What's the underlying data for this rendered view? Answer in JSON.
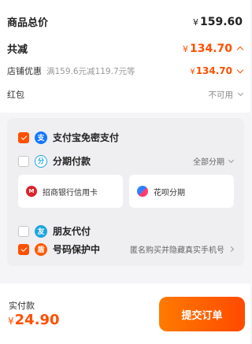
{
  "summary": {
    "total_label": "商品总价",
    "total_currency": "¥",
    "total_value": "159.60",
    "discount_label": "共减",
    "discount_currency": "¥",
    "discount_value": "134.70",
    "store_label": "店铺优惠",
    "store_desc": "满159.6元减119.7元等",
    "store_currency": "¥",
    "store_value": "134.70",
    "redpack_label": "红包",
    "redpack_value": "不可用"
  },
  "payment": {
    "alipay_label": "支付宝免密支付",
    "alipay_checked": true,
    "installment_label": "分期付款",
    "installment_checked": false,
    "installment_link": "全部分期",
    "banks": [
      "招商银行信用卡",
      "花呗分期"
    ],
    "friend_label": "朋友代付",
    "friend_checked": false,
    "privacy_label": "号码保护中",
    "privacy_checked": true,
    "privacy_desc": "匿名购买并隐藏真实手机号"
  },
  "footer": {
    "pay_label": "实付款",
    "pay_currency": "¥",
    "pay_value": "24.90",
    "submit_label": "提交订单"
  },
  "colors": {
    "accent": "#ff5000",
    "alipay": "#1677ff"
  }
}
